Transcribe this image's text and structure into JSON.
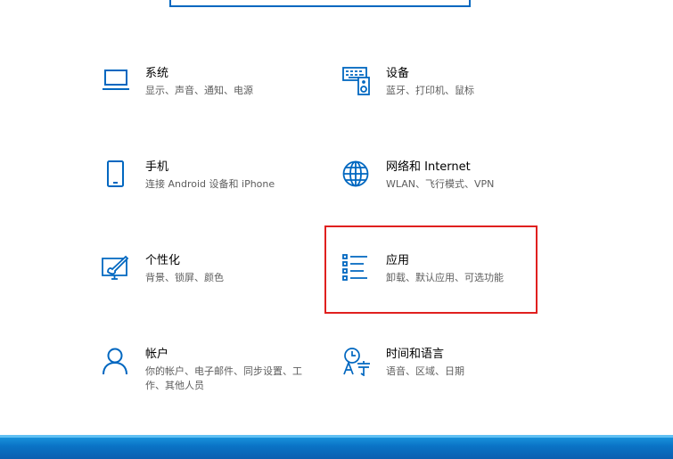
{
  "tiles": [
    {
      "icon": "laptop-icon",
      "title": "系统",
      "desc": "显示、声音、通知、电源"
    },
    {
      "icon": "keyboard-speaker-icon",
      "title": "设备",
      "desc": "蓝牙、打印机、鼠标"
    },
    {
      "icon": "phone-icon",
      "title": "手机",
      "desc": "连接 Android 设备和 iPhone"
    },
    {
      "icon": "globe-icon",
      "title": "网络和 Internet",
      "desc": "WLAN、飞行模式、VPN"
    },
    {
      "icon": "paint-icon",
      "title": "个性化",
      "desc": "背景、锁屏、颜色"
    },
    {
      "icon": "apps-list-icon",
      "title": "应用",
      "desc": "卸载、默认应用、可选功能"
    },
    {
      "icon": "person-icon",
      "title": "帐户",
      "desc": "你的帐户、电子邮件、同步设置、工作、其他人员"
    },
    {
      "icon": "time-language-icon",
      "title": "时间和语言",
      "desc": "语音、区域、日期"
    }
  ],
  "colors": {
    "icon_blue": "#0067c0",
    "highlight_red": "#e0201f",
    "taskbar_blue": "#0a74c6"
  }
}
